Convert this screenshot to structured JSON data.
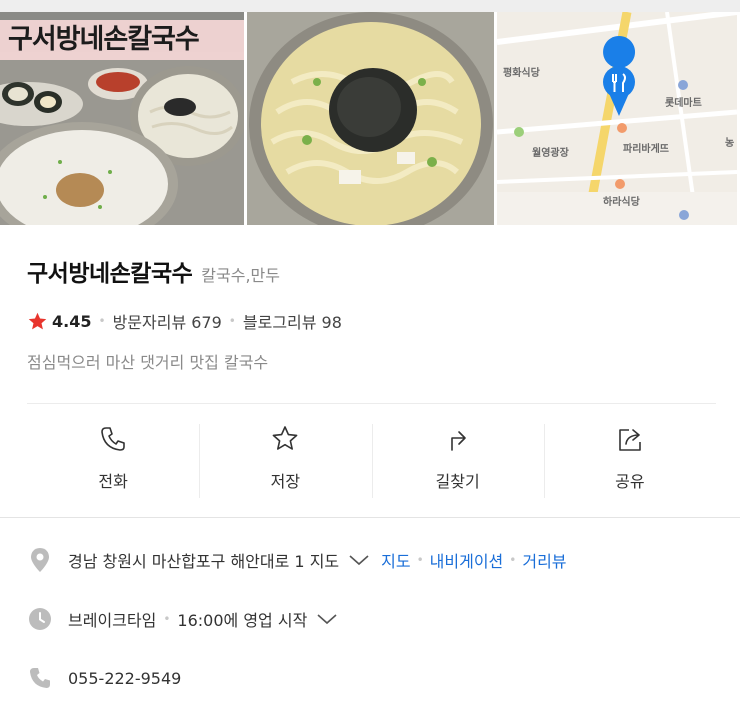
{
  "photo_title": "구서방네손칼국수",
  "map_labels": {
    "peace": "평화식당",
    "lotte": "롯데마트",
    "wolyoung": "월영광장",
    "paris": "파리바게뜨",
    "hara": "하라식당",
    "side": "농"
  },
  "place": {
    "name": "구서방네손칼국수",
    "category": "칼국수,만두"
  },
  "rating": {
    "score": "4.45",
    "visitor_reviews": "방문자리뷰 679",
    "blog_reviews": "블로그리뷰 98"
  },
  "description": "점심먹으러 마산 댓거리 맛집 칼국수",
  "actions": [
    {
      "label": "전화",
      "icon": "phone-icon"
    },
    {
      "label": "저장",
      "icon": "star-outline-icon"
    },
    {
      "label": "길찾기",
      "icon": "directions-arrow-icon"
    },
    {
      "label": "공유",
      "icon": "share-icon"
    }
  ],
  "address": {
    "text": "경남 창원시 마산합포구 해안대로 1 지도",
    "links": [
      "지도",
      "내비게이션",
      "거리뷰"
    ]
  },
  "hours": {
    "status": "브레이크타임",
    "detail": "16:00에 영업 시작"
  },
  "phone": "055-222-9549",
  "colors": {
    "link": "#1a6ed8",
    "rating_star": "#e8352d",
    "map_pin": "#1a7fe8"
  }
}
